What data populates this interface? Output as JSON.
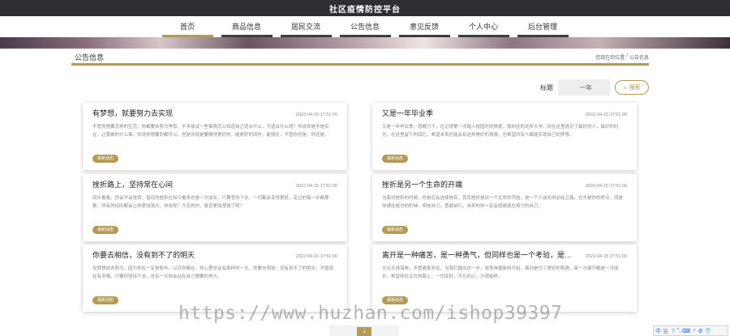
{
  "site": {
    "title": "社区疫情防控平台"
  },
  "nav": {
    "items": [
      {
        "label": "首页",
        "active": true
      },
      {
        "label": "商品信息",
        "active": false
      },
      {
        "label": "居民交流",
        "active": false
      },
      {
        "label": "公告信息",
        "active": false
      },
      {
        "label": "意见反馈",
        "active": false
      },
      {
        "label": "个人中心",
        "active": false
      },
      {
        "label": "后台管理",
        "active": false
      }
    ]
  },
  "section": {
    "title": "公告信息",
    "breadcrumb": {
      "home": "您现在的位置",
      "sep": "/",
      "current": "公告信息"
    }
  },
  "search": {
    "label": "标题",
    "value": "一年",
    "placeholder": "标题",
    "button_label": "搜索"
  },
  "notices": [
    {
      "title": "有梦想，就要努力去实现",
      "time": "2022-04-15 17:51:20",
      "summary": "不管你想要怎样的生活，你都要去努力争取，不多尝试一些事情怎么知道自己适合什么，不适合什么呢？你说你是不是实在，让我做的什么事，你说你想要的都可以，但是你就是要做得更好的，能更好的同时，能强化，不管你还是。你还是。",
      "tag": "最新动态"
    },
    {
      "title": "又是一年毕业季",
      "time": "2022-04-15 17:51:00",
      "summary": "又是一年毕业季，感概万千，还记得第一次踏入校园时的情景，我向往的这所大学，你在这里遇见了最好的人，最好的时光，在这里留下的回忆，希望未来还能会有这样美好的场景，也希望所有人都能实现自己的梦想。",
      "tag": "最新动态"
    },
    {
      "title": "挫折路上，坚持常在心间",
      "time": "2022-04-15 17:51:00",
      "summary": "回头看看，你会不会觉得，曾经的挫折在如今看来也是一次成长，只要坚持下去，一切都会变得更好，走过的每一步都算数，所有的经历都会让你更加强大，你说呢？今天的你，是否更加坚强了呢？",
      "tag": "最新动态"
    },
    {
      "title": "挫折是另一个生命的开端",
      "time": "2022-04-15 17:51:00",
      "summary": "当面对挫折的时候，你是否会选择放弃，其实挫折是另一个生命的开始，是一个人成长的必经之路，它不是你的终点，而是你通往成功的阶梯，相信自己，勇敢前行，未来的你一定会感谢现在努力的自己。",
      "tag": "最新动态"
    },
    {
      "title": "你要去相信，没有到不了的明天",
      "time": "2022-04-15 17:51:00",
      "summary": "有梦想就去努力，因为你在一定是那年，以后你都在，你心里总会有那样的一天，你要去相信，没有到不了的明天，不管现在有多难，只要你坚持下去，总有一天你会站在自己想要的地方。",
      "tag": "最新动态"
    },
    {
      "title": "离开是一种痛苦，是一种勇气，但同样也是一个考验，是一个新...",
      "time": "2022-04-15 17:51:00",
      "summary": "无论天涯海角，不管离家多远，当我们踏出这一步，就意味着新的开始，离别是为了更好的相遇，每一次离开都是一次成长，希望你在远方的路上，一切安好，不忘初心，方得始终。",
      "tag": "最新动态"
    }
  ],
  "pagination": {
    "current": "1"
  },
  "watermark": "https://www.huzhan.com/ishop39397",
  "ime": {
    "glyphs": [
      "中",
      "ㄓ",
      "☽",
      "°,",
      "⌨",
      "♂",
      "⚙",
      "👕"
    ]
  }
}
